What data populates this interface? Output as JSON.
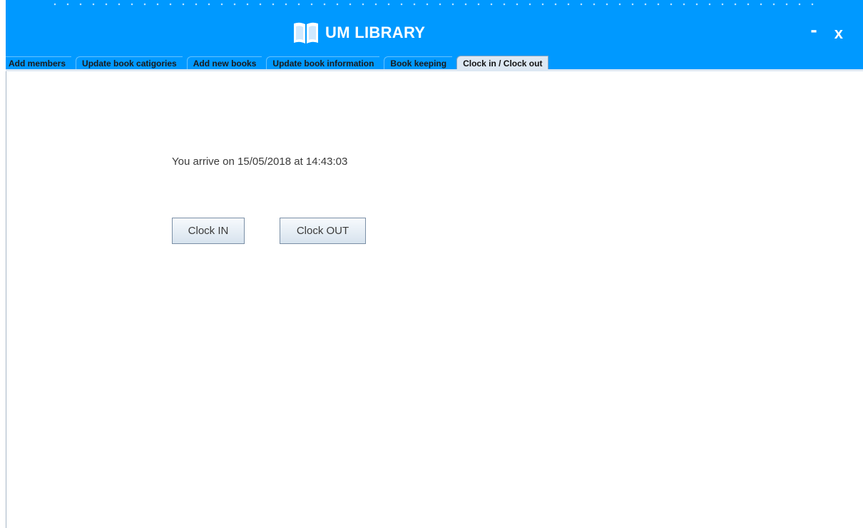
{
  "window": {
    "title": "UM LIBRARY",
    "minimize_label": "-",
    "close_label": "x"
  },
  "tabs": [
    {
      "label": "Add members",
      "active": false
    },
    {
      "label": "Update book catigories",
      "active": false
    },
    {
      "label": "Add new books",
      "active": false
    },
    {
      "label": "Update book information",
      "active": false
    },
    {
      "label": "Book keeping",
      "active": false
    },
    {
      "label": "Clock in / Clock out",
      "active": true
    }
  ],
  "clock_panel": {
    "arrival_message": "You arrive on 15/05/2018 at 14:43:03",
    "clock_in_label": "Clock IN",
    "clock_out_label": "Clock OUT"
  },
  "icons": {
    "title_icon": "open-book-icon"
  },
  "colors": {
    "header_background": "#0099ff",
    "active_tab_background": "#dde8f3",
    "text_dark": "#3a3a3a"
  }
}
